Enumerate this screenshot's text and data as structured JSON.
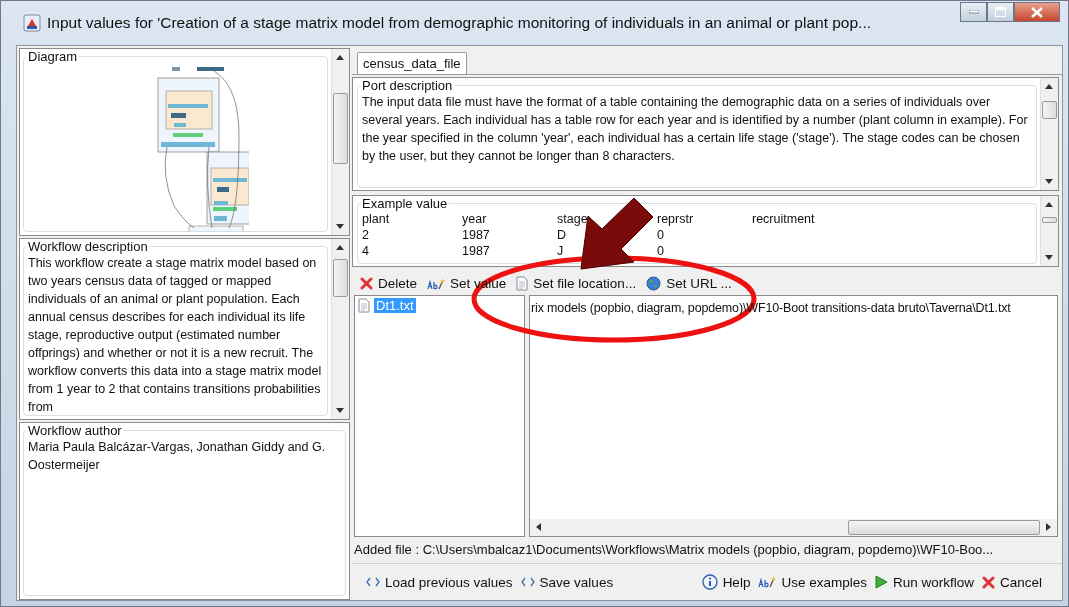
{
  "window": {
    "title": "Input values for 'Creation of a stage matrix model from demographic monitoring of individuals in an animal or plant pop..."
  },
  "diagram": {
    "title": "Diagram"
  },
  "workflow_description": {
    "title": "Workflow description",
    "text": "This workflow create a stage matrix model based on two years census data of tagged or mapped individuals of an animal or plant population. Each annual census describes for each individual its life stage, reproductive output (estimated number offprings) and whether or not it is a new recruit. The workflow converts this data into a stage matrix model from 1 year to 2 that contains transitions probabilities from"
  },
  "workflow_author": {
    "title": "Workflow author",
    "text": "Maria Paula Balcázar-Vargas, Jonathan Giddy and G. Oostermeijer"
  },
  "tabs": [
    {
      "label": "census_data_file",
      "selected": true
    }
  ],
  "port_description": {
    "title": "Port description",
    "text": "The input data file must have the format of a table containing the demographic data on a series of individuals over several years. Each individual has a table row for each year and is identified by a number (plant column in example). For the year specified in the column 'year', each individual has a certain life stage ('stage'). The stage codes can be chosen by the user, but they cannot be longer than 8 characters."
  },
  "example_value": {
    "title": "Example value",
    "columns": [
      "plant",
      "year",
      "stage",
      "reprstr",
      "recruitment"
    ],
    "rows": [
      [
        "2",
        "1987",
        "D",
        "0"
      ],
      [
        "4",
        "1987",
        "J",
        "0"
      ]
    ]
  },
  "toolbar": [
    {
      "kind": "delete",
      "label": "Delete"
    },
    {
      "kind": "value",
      "label": "Set value"
    },
    {
      "kind": "file",
      "label": "Set file location..."
    },
    {
      "kind": "url",
      "label": "Set URL ..."
    }
  ],
  "files": [
    {
      "name": "Dt1.txt",
      "selected": true
    }
  ],
  "file_value": "rix models (popbio, diagram, popdemo)\\WF10-Boot transitions-data bruto\\Taverna\\Dt1.txt",
  "status": "Added file : C:\\Users\\mbalcaz1\\Documents\\Workflows\\Matrix models (popbio, diagram, popdemo)\\WF10-Boo...",
  "buttons_left": [
    {
      "label": "Load previous values"
    },
    {
      "label": "Save values"
    }
  ],
  "buttons_right": [
    {
      "kind": "help",
      "label": "Help"
    },
    {
      "kind": "examples",
      "label": "Use examples"
    },
    {
      "kind": "run",
      "label": "Run workflow"
    },
    {
      "kind": "cancel",
      "label": "Cancel"
    }
  ]
}
